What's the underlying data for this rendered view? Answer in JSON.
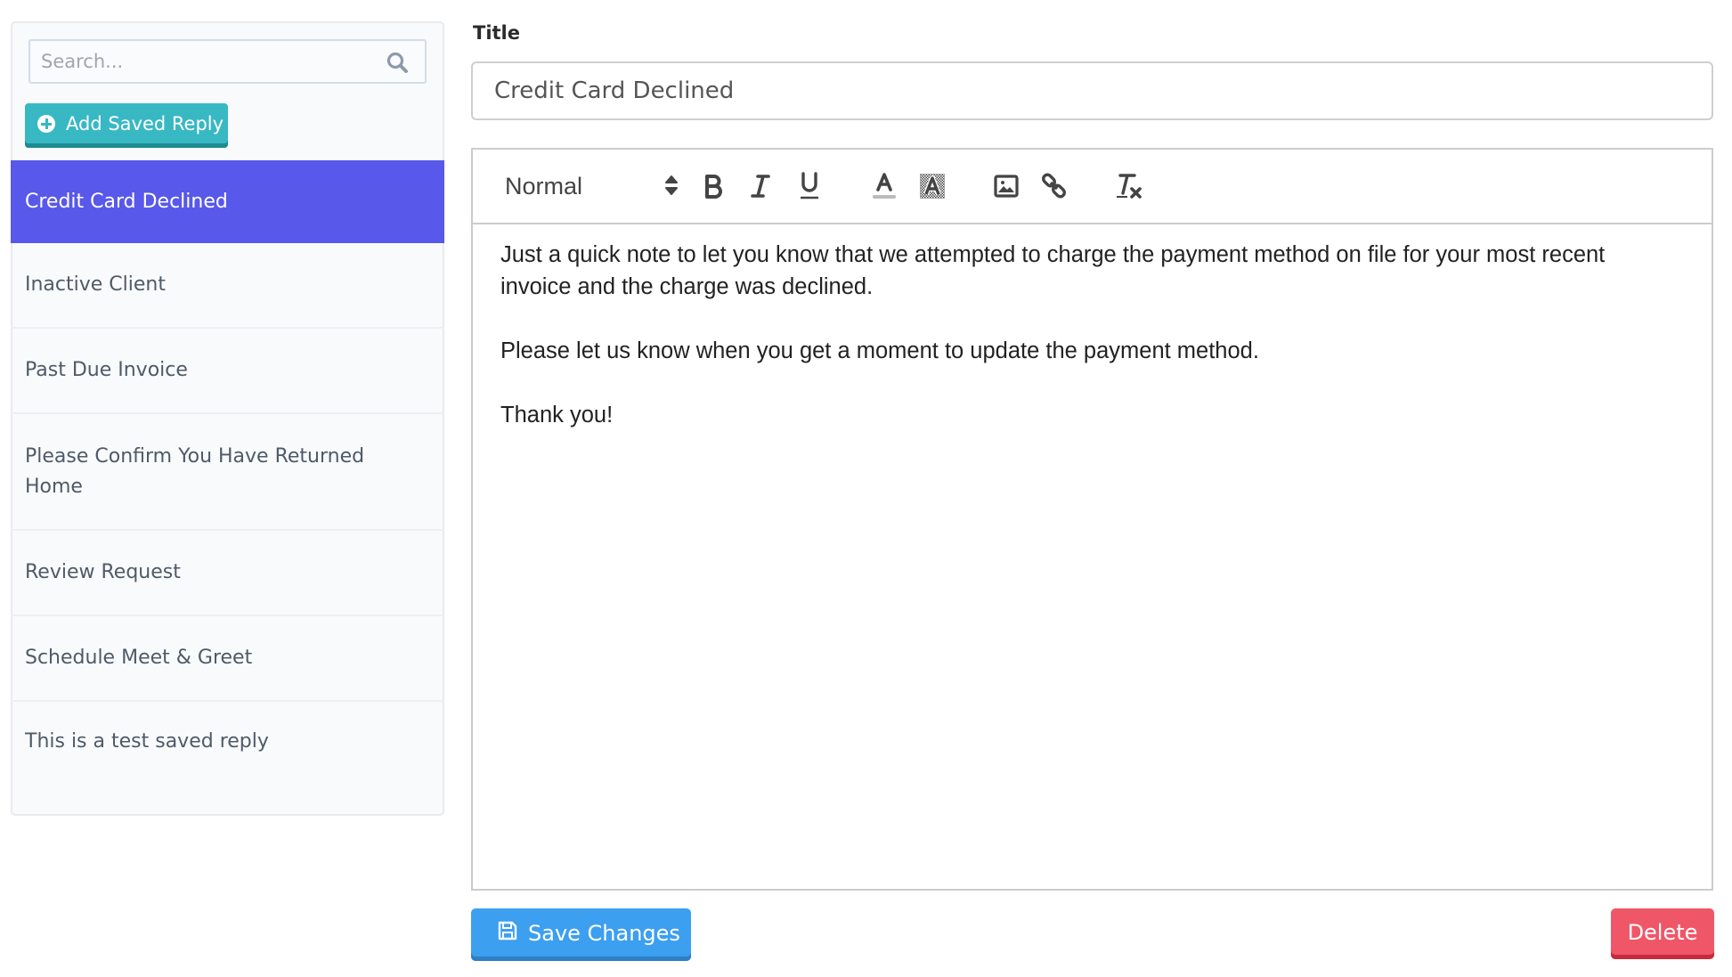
{
  "sidebar": {
    "search": {
      "placeholder": "Search...",
      "value": "",
      "icon": "search-icon"
    },
    "add_button": {
      "label": "Add Saved Reply",
      "icon": "plus-circle-icon",
      "color": "#38b8c3"
    },
    "selected_index": 0,
    "active_color": "#5858ea",
    "items": [
      {
        "label": "Credit Card Declined"
      },
      {
        "label": "Inactive Client"
      },
      {
        "label": "Past Due Invoice"
      },
      {
        "label": "Please Confirm You Have Returned Home"
      },
      {
        "label": "Review Request"
      },
      {
        "label": "Schedule Meet & Greet"
      },
      {
        "label": "This is a test saved reply"
      }
    ]
  },
  "form": {
    "title_label": "Title",
    "title_value": "Credit Card Declined",
    "editor": {
      "toolbar": {
        "header_select": "Normal",
        "buttons": [
          {
            "name": "bold",
            "icon": "bold-icon"
          },
          {
            "name": "italic",
            "icon": "italic-icon"
          },
          {
            "name": "underline",
            "icon": "underline-icon"
          },
          {
            "name": "text-color",
            "icon": "font-color-icon"
          },
          {
            "name": "background-color",
            "icon": "highlight-icon"
          },
          {
            "name": "image",
            "icon": "image-icon"
          },
          {
            "name": "link",
            "icon": "link-icon"
          },
          {
            "name": "clean",
            "icon": "clear-format-icon"
          }
        ]
      },
      "paragraphs": [
        "Just a quick note to let you know that we attempted to charge the payment method on file for your most recent invoice and the charge was declined.",
        "",
        "Please let us know when you get a moment to update the payment method.",
        "",
        "Thank you!"
      ]
    },
    "save_button": {
      "label": "Save Changes",
      "icon": "save-icon",
      "color": "#3c9ff0"
    },
    "delete_button": {
      "label": "Delete",
      "color": "#ef5768"
    }
  }
}
